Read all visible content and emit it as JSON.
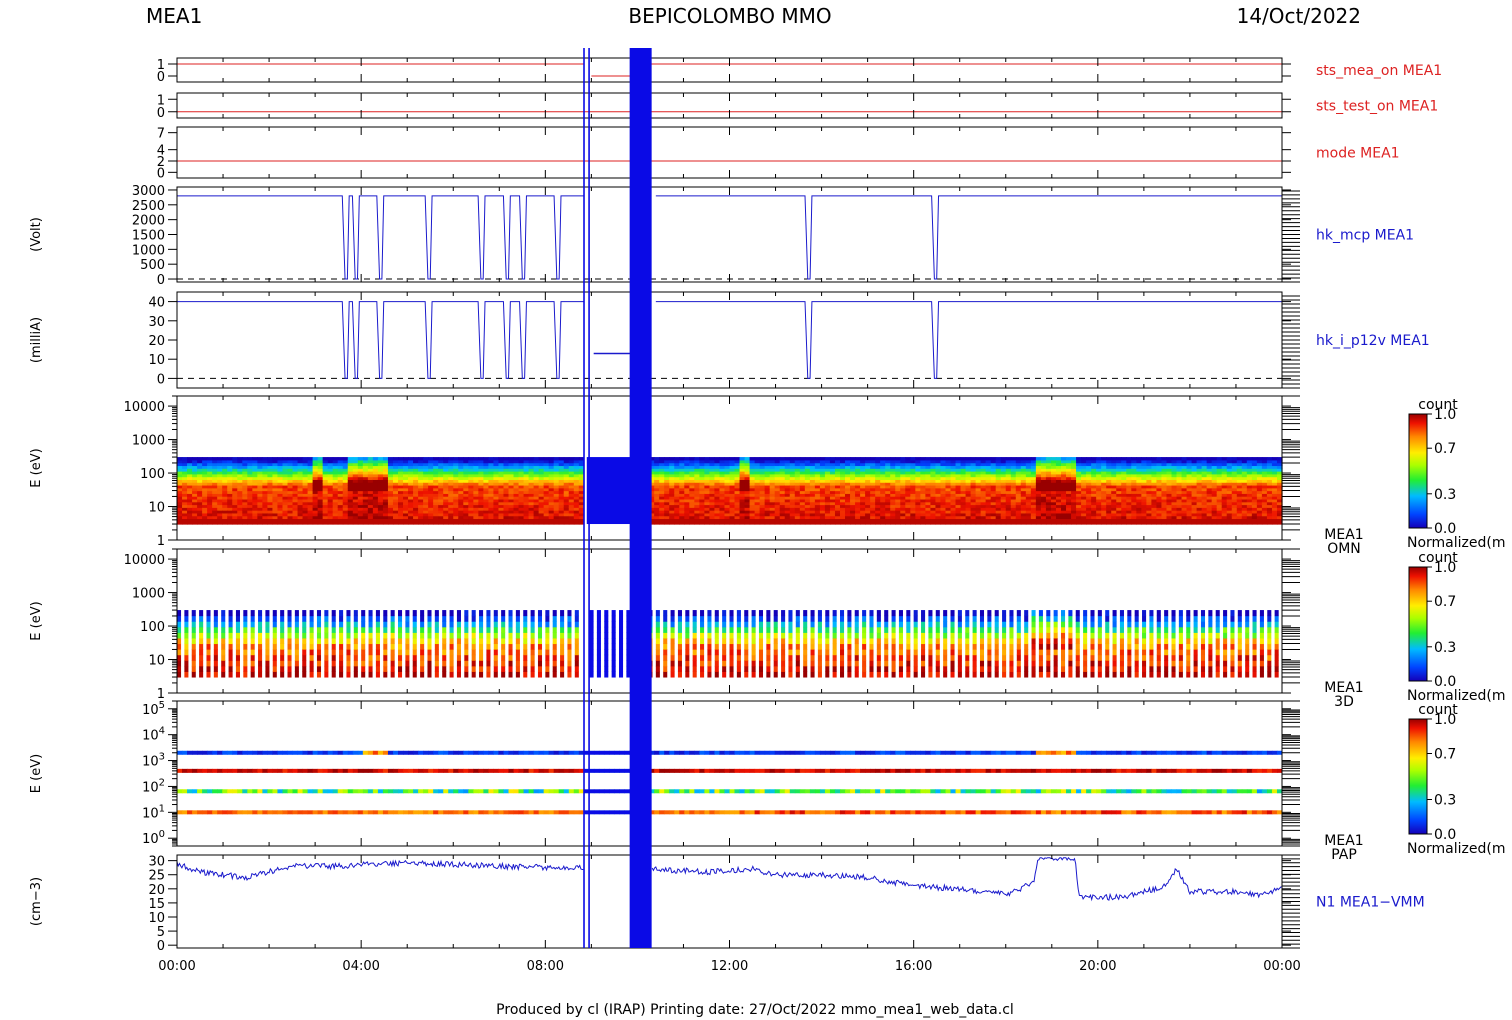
{
  "header": {
    "left": "MEA1",
    "center": "BEPICOLOMBO MMO",
    "right": "14/Oct/2022"
  },
  "footer": "Produced by cl (IRAP)   Printing date: 27/Oct/2022   mmo_mea1_web_data.cl",
  "colors": {
    "red_trace": "#dd2222",
    "blue_trace": "#1a1acc",
    "gap_bar": "#0a0ae6",
    "axes": "#000000"
  },
  "colorbar": {
    "title": "count",
    "label": "Normalized(m",
    "ticks": [
      "1.0",
      "0.7",
      "0.3",
      "0.0"
    ]
  },
  "chart_data": {
    "type": "multi-panel time series with spectrograms",
    "x": {
      "unit": "hour",
      "range": [
        0,
        24
      ],
      "tick_labels": [
        "00:00",
        "04:00",
        "08:00",
        "12:00",
        "16:00",
        "20:00",
        "00:00"
      ],
      "tick_values": [
        0,
        4,
        8,
        12,
        16,
        20,
        24
      ]
    },
    "gap_markers_hours": [
      8.84,
      8.95,
      9.88,
      9.92,
      9.96,
      10.0,
      10.04,
      10.08,
      10.12,
      10.16,
      10.2,
      10.26
    ],
    "panels": [
      {
        "id": "sts_mea_on",
        "type": "line",
        "ylabel": "",
        "label": "sts_mea_on MEA1",
        "color": "red",
        "yrange": [
          -0.5,
          1.5
        ],
        "yticks": [
          0,
          1
        ],
        "ytick_labels": [
          "0",
          "1"
        ],
        "ticks_side": "both",
        "segments": [
          {
            "x": [
              0,
              8.84
            ],
            "y": [
              1,
              1
            ]
          },
          {
            "x": [
              9.0,
              9.88
            ],
            "y": [
              0,
              0
            ]
          },
          {
            "x": [
              10.26,
              24
            ],
            "y": [
              1,
              1
            ]
          }
        ]
      },
      {
        "id": "sts_test_on",
        "type": "line",
        "ylabel": "",
        "label": "sts_test_on MEA1",
        "color": "red",
        "yrange": [
          -0.5,
          1.5
        ],
        "yticks": [
          0,
          1
        ],
        "ytick_labels": [
          "0",
          "1"
        ],
        "ticks_side": "both",
        "segments": [
          {
            "x": [
              0,
              24
            ],
            "y": [
              0,
              0
            ]
          }
        ]
      },
      {
        "id": "mode",
        "type": "line",
        "ylabel": "",
        "label": "mode MEA1",
        "color": "red",
        "yrange": [
          -1,
          8
        ],
        "yticks": [
          0,
          2,
          4,
          7
        ],
        "ytick_labels": [
          "0",
          "2",
          "4",
          "7"
        ],
        "ticks_side": "both",
        "segments": [
          {
            "x": [
              0,
              24
            ],
            "y": [
              2,
              2
            ]
          }
        ]
      },
      {
        "id": "hk_mcp",
        "type": "line",
        "ylabel": "(Volt)",
        "label": "hk_mcp MEA1",
        "color": "blue",
        "yrange": [
          -100,
          3100
        ],
        "yticks": [
          0,
          500,
          1000,
          1500,
          2000,
          2500,
          3000
        ],
        "ytick_labels": [
          "0",
          "500",
          "1000",
          "1500",
          "2000",
          "2500",
          "3000"
        ],
        "ticks_side": "both",
        "baseline": 0,
        "level": 2800,
        "dips_hours": [
          3.65,
          3.87,
          4.4,
          5.45,
          6.6,
          7.15,
          7.5,
          8.25,
          13.7,
          16.45
        ],
        "gap": [
          8.84,
          10.26
        ],
        "end_after_gap": 0
      },
      {
        "id": "hk_i_p12v",
        "type": "line",
        "ylabel": "(milliA)",
        "label": "hk_i_p12v MEA1",
        "color": "blue",
        "yrange": [
          -5,
          45
        ],
        "yticks": [
          0,
          10,
          20,
          30,
          40
        ],
        "ytick_labels": [
          "0",
          "10",
          "20",
          "30",
          "40"
        ],
        "ticks_side": "both",
        "baseline": 0,
        "level": 40,
        "dips_hours": [
          3.65,
          3.87,
          4.4,
          5.45,
          6.6,
          7.15,
          7.5,
          8.25,
          13.7,
          16.45
        ],
        "gap_level": 13,
        "gap_level_range": [
          9.05,
          9.85
        ]
      },
      {
        "id": "omn",
        "type": "heatmap",
        "ylabel": "E (eV)",
        "label": [
          "MEA1",
          "OMN"
        ],
        "yscale": "log",
        "yrange": [
          1,
          20000
        ],
        "yticks": [
          1,
          10,
          100,
          1000,
          10000
        ],
        "ytick_labels": [
          "1",
          "10",
          "100",
          "1000",
          "10000"
        ],
        "ticks_side": "both",
        "energy_range": [
          3,
          300
        ],
        "colorbar": true,
        "enhancements_hours": [
          [
            3.0,
            3.2
          ],
          [
            3.7,
            4.6
          ],
          [
            12.2,
            12.4
          ],
          [
            18.7,
            19.5
          ]
        ]
      },
      {
        "id": "3d",
        "type": "heatmap",
        "ylabel": "E (eV)",
        "label": [
          "MEA1",
          "3D"
        ],
        "yscale": "log",
        "yrange": [
          1,
          20000
        ],
        "yticks": [
          1,
          10,
          100,
          1000,
          10000
        ],
        "ytick_labels": [
          "1",
          "10",
          "100",
          "1000",
          "10000"
        ],
        "ticks_side": "both",
        "energy_range": [
          3,
          300
        ],
        "colorbar": true,
        "striped": true
      },
      {
        "id": "pap",
        "type": "heatmap",
        "ylabel": "E (eV)",
        "label": [
          "MEA1",
          "PAP"
        ],
        "yscale": "log",
        "yrange": [
          0.5,
          200000
        ],
        "yticks": [
          1,
          10,
          100,
          1000,
          10000,
          100000
        ],
        "ytick_labels": [
          "10",
          "10",
          "10",
          "10",
          "10",
          "10"
        ],
        "ytick_exponents": [
          "0",
          "1",
          "2",
          "3",
          "4",
          "5"
        ],
        "ticks_side": "both",
        "bands": [
          {
            "energy": 2000,
            "base": "blue"
          },
          {
            "energy": 400,
            "base": "red"
          },
          {
            "energy": 65,
            "base": "green"
          },
          {
            "energy": 10,
            "base": "orange"
          }
        ],
        "colorbar": true
      },
      {
        "id": "n1",
        "type": "line",
        "ylabel": "(cm−3)",
        "label": "N1 MEA1−VMM",
        "color": "blue",
        "yrange": [
          -1,
          32
        ],
        "yticks": [
          0,
          5,
          10,
          15,
          20,
          25,
          30
        ],
        "ytick_labels": [
          "0",
          "5",
          "10",
          "15",
          "20",
          "25",
          "30"
        ],
        "ticks_side": "both",
        "profile": [
          [
            0,
            29
          ],
          [
            0.5,
            26
          ],
          [
            1.5,
            24
          ],
          [
            2.5,
            28
          ],
          [
            3.5,
            28
          ],
          [
            4.5,
            29
          ],
          [
            5.5,
            29
          ],
          [
            7,
            28
          ],
          [
            8.5,
            27.5
          ],
          [
            10.3,
            27
          ],
          [
            11.5,
            26
          ],
          [
            12.5,
            27
          ],
          [
            13,
            25
          ],
          [
            14,
            25
          ],
          [
            15,
            24
          ],
          [
            16,
            21
          ],
          [
            17,
            20
          ],
          [
            18,
            18
          ],
          [
            18.6,
            22
          ],
          [
            18.7,
            31
          ],
          [
            19.5,
            31
          ],
          [
            19.6,
            17
          ],
          [
            20.5,
            17
          ],
          [
            21,
            19
          ],
          [
            21.5,
            21
          ],
          [
            21.7,
            27
          ],
          [
            22,
            19
          ],
          [
            23,
            19
          ],
          [
            23.5,
            18
          ],
          [
            24,
            20
          ]
        ]
      }
    ]
  }
}
